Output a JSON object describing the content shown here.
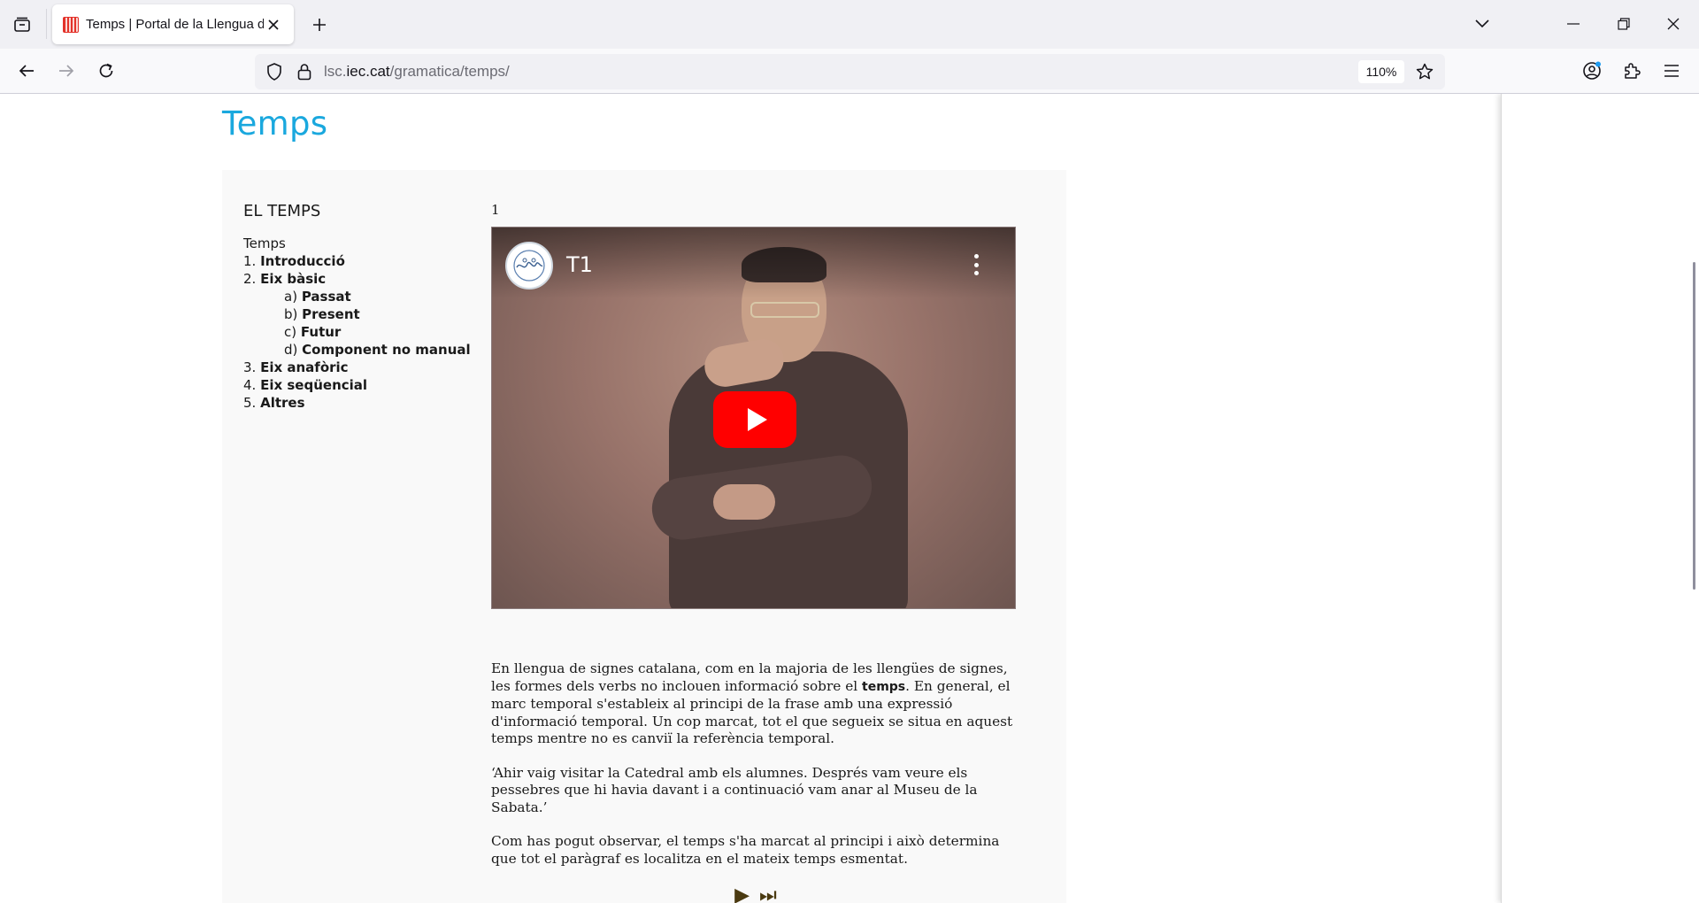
{
  "browser": {
    "tab_title": "Temps | Portal de la Llengua de",
    "url_prefix": "lsc.",
    "url_domain": "iec.cat",
    "url_path": "/gramatica/temps/",
    "zoom": "110%"
  },
  "page": {
    "title": "Temps",
    "toc": {
      "heading": "EL TEMPS",
      "root": "Temps",
      "items": [
        {
          "num": "1.",
          "label": "Introducció"
        },
        {
          "num": "2.",
          "label": "Eix bàsic"
        },
        {
          "num": "a)",
          "label": "Passat"
        },
        {
          "num": "b)",
          "label": "Present"
        },
        {
          "num": "c)",
          "label": "Futur"
        },
        {
          "num": "d)",
          "label": "Component no manual"
        },
        {
          "num": "3.",
          "label": "Eix anafòric"
        },
        {
          "num": "4.",
          "label": "Eix seqüencial"
        },
        {
          "num": "5.",
          "label": "Altres"
        }
      ]
    },
    "video": {
      "number": "1",
      "title": "T1"
    },
    "paragraphs": {
      "p1_before": "En llengua de signes catalana, com en la majoria de les llengües de signes, les formes dels verbs no inclouen informació sobre el ",
      "p1_bold": "temps",
      "p1_after": ". En general, el marc temporal s'estableix al principi de la frase amb una expressió d'informació temporal. Un cop marcat, tot el que segueix se situa en aquest temps mentre no es canviï la referència temporal.",
      "p2": "‘Ahir vaig visitar la Catedral amb els alumnes. Després vam veure els pessebres que hi havia davant i a continuació vam anar al Museu de la Sabata.’",
      "p3": "Com has pogut observar, el temps s'ha marcat al principi i això determina que tot el paràgraf es localitza en el mateix temps esmentat."
    },
    "controls": {
      "play": "▶",
      "next": "⏭"
    }
  }
}
